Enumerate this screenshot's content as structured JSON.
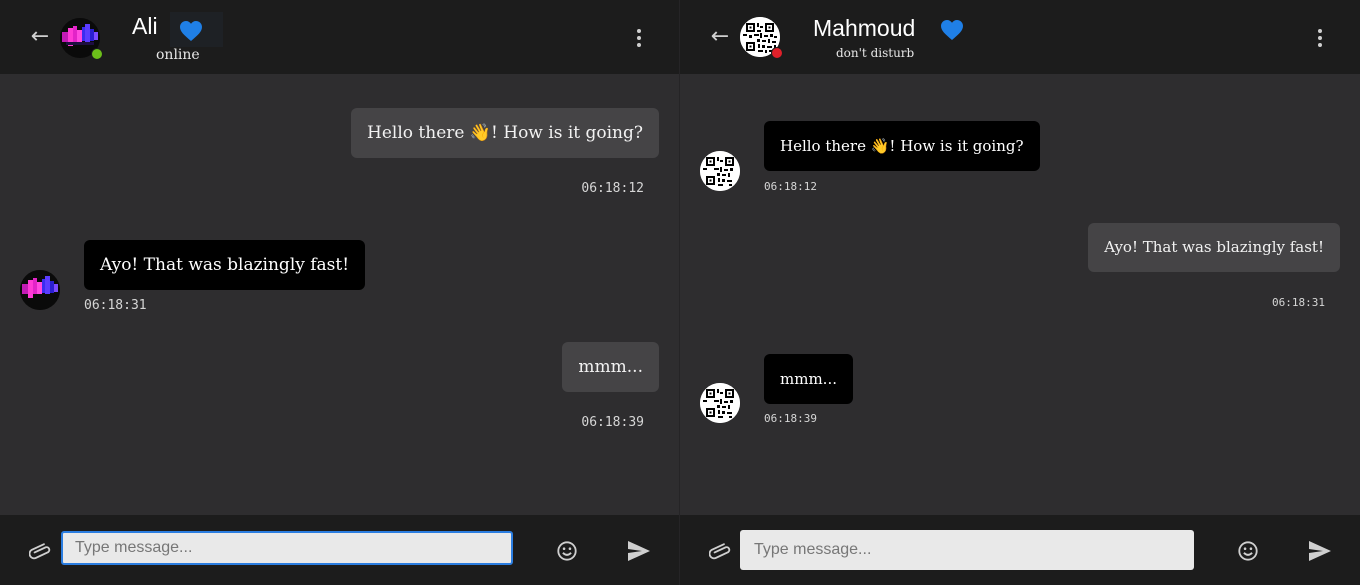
{
  "left": {
    "header": {
      "name": "Ali",
      "status": "online",
      "status_color": "#6cbf1a",
      "back_icon": "←"
    },
    "messages": [
      {
        "direction": "out",
        "text": "Hello there 👋! How is it going?",
        "time": "06:18:12"
      },
      {
        "direction": "in",
        "text": "Ayo! That was blazingly fast!",
        "time": "06:18:31"
      },
      {
        "direction": "out",
        "text": "mmm...",
        "time": "06:18:39"
      }
    ],
    "composer": {
      "placeholder": "Type message...",
      "value": ""
    }
  },
  "right": {
    "header": {
      "name": "Mahmoud",
      "status": "don't disturb",
      "status_color": "#e0202a",
      "back_icon": "←"
    },
    "messages": [
      {
        "direction": "in",
        "text": "Hello there 👋! How is it going?",
        "time": "06:18:12"
      },
      {
        "direction": "out",
        "text": "Ayo! That was blazingly fast!",
        "time": "06:18:31"
      },
      {
        "direction": "in",
        "text": "mmm...",
        "time": "06:18:39"
      }
    ],
    "composer": {
      "placeholder": "Type message...",
      "value": ""
    }
  },
  "colors": {
    "heart": "#1f7fe6",
    "accent": "#2b7de0"
  }
}
